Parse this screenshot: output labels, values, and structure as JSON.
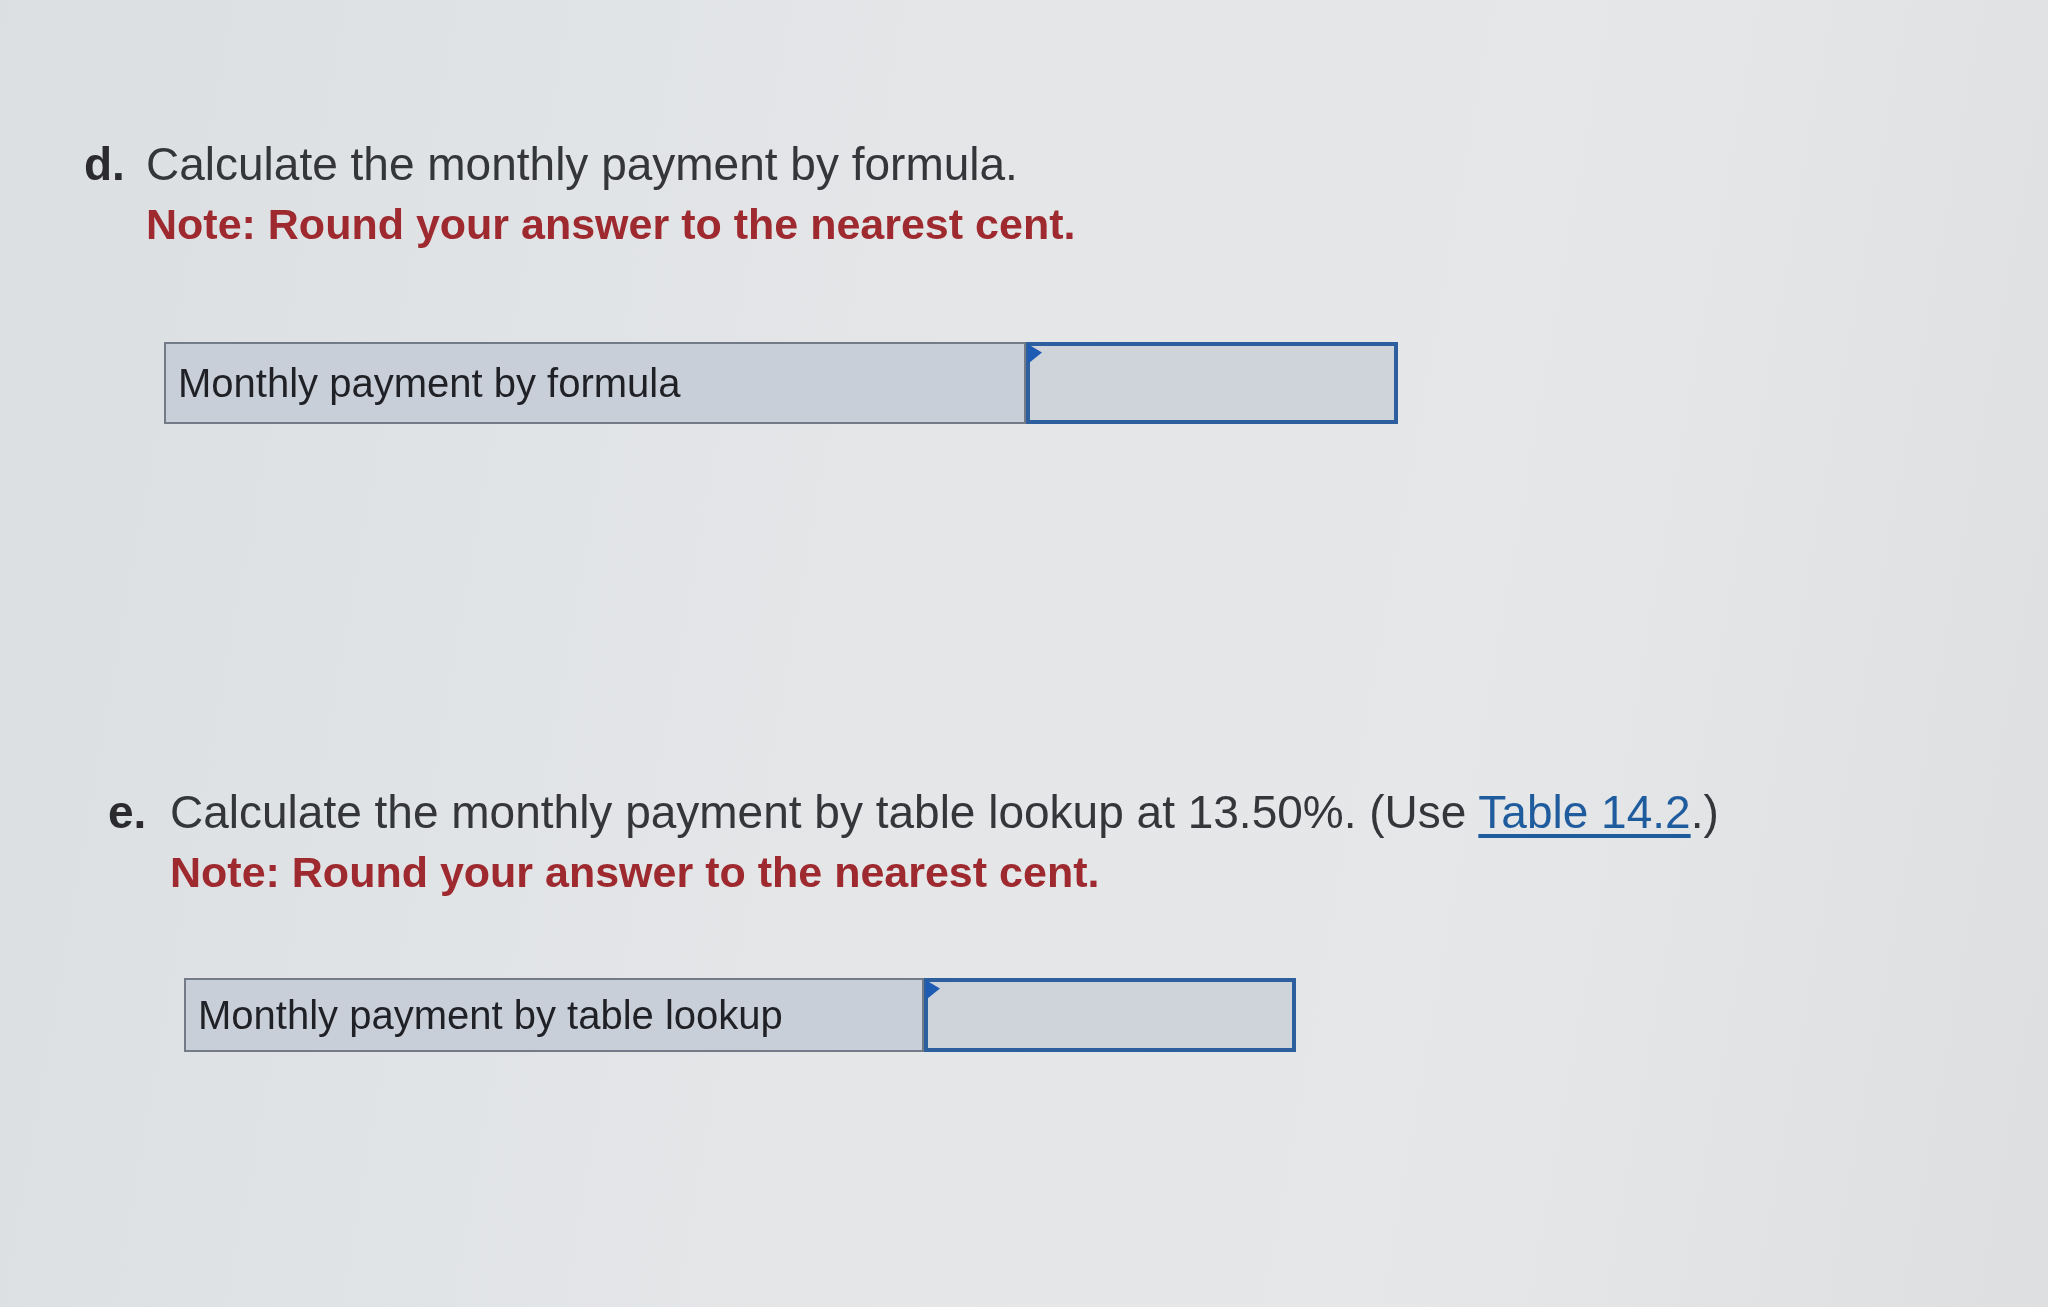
{
  "questions": [
    {
      "letter": "d.",
      "prompt": [
        {
          "kind": "text",
          "text": "Calculate the monthly payment by formula."
        }
      ],
      "note": "Note: Round your answer to the nearest cent.",
      "answer_row": {
        "label": "Monthly payment by formula"
      }
    },
    {
      "letter": "e.",
      "prompt": [
        {
          "kind": "text",
          "text": "Calculate the monthly payment by table lookup at 13.50%. (Use "
        },
        {
          "kind": "link",
          "text": "Table 14.2"
        },
        {
          "kind": "text",
          "text": ".)"
        }
      ],
      "note": "Note: Round your answer to the nearest cent.",
      "answer_row": {
        "label": "Monthly payment by table lookup"
      }
    }
  ]
}
